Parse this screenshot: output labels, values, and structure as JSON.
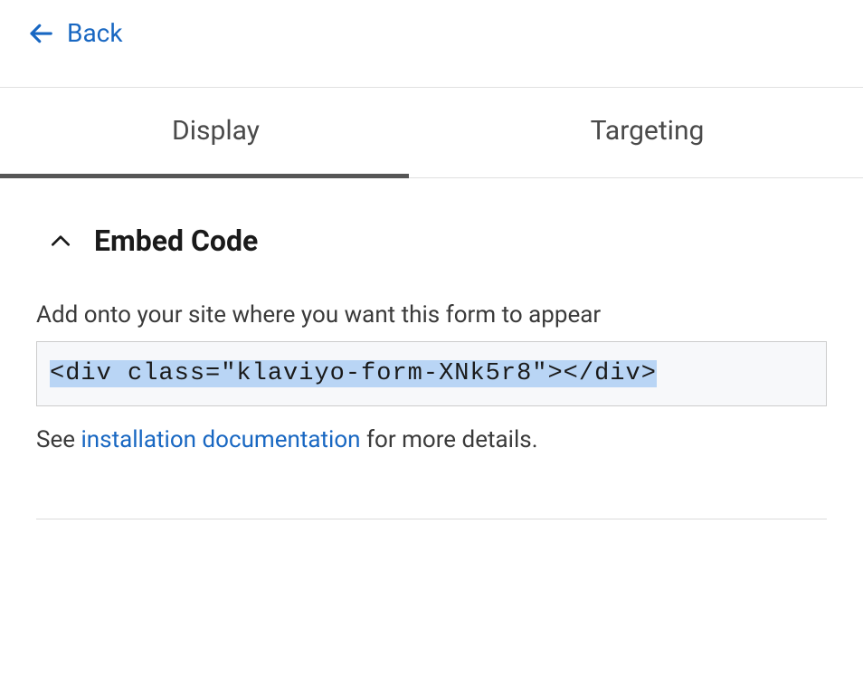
{
  "header": {
    "back_label": "Back"
  },
  "tabs": [
    {
      "label": "Display",
      "active": true
    },
    {
      "label": "Targeting",
      "active": false
    }
  ],
  "embed_section": {
    "title": "Embed Code",
    "description": "Add onto your site where you want this form to appear",
    "code": "<div class=\"klaviyo-form-XNk5r8\"></div>",
    "help_prefix": "See ",
    "help_link_text": "installation documentation",
    "help_suffix": " for more details."
  }
}
